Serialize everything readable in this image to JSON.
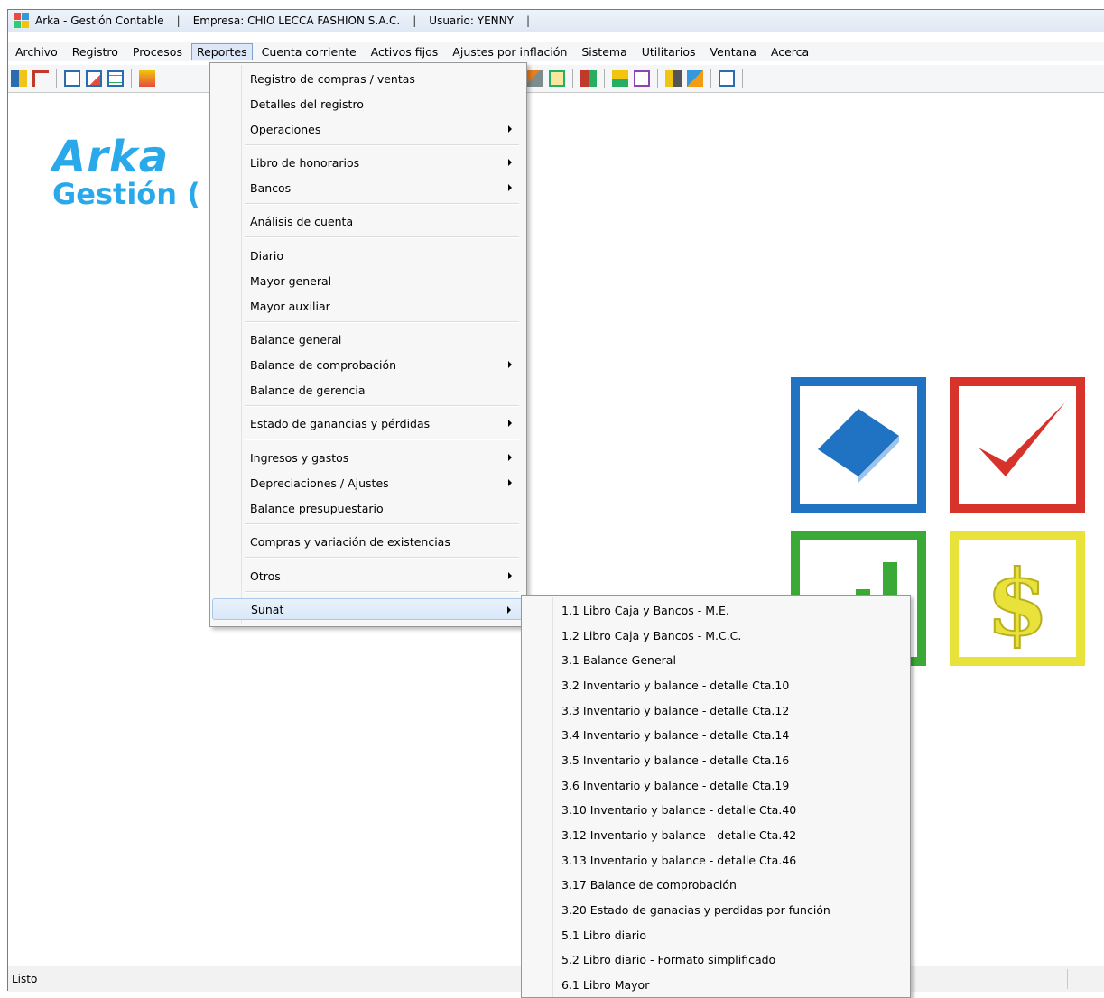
{
  "titlebar": {
    "app_title": "Arka - Gestión Contable",
    "company": "Empresa: CHIO LECCA FASHION S.A.C.",
    "user": "Usuario: YENNY",
    "separator": "|"
  },
  "menubar": {
    "items": [
      "Archivo",
      "Registro",
      "Procesos",
      "Reportes",
      "Cuenta corriente",
      "Activos fijos",
      "Ajustes por inflación",
      "Sistema",
      "Utilitarios",
      "Ventana",
      "Acerca"
    ],
    "active": "Reportes"
  },
  "logo": {
    "name": "Arka",
    "subtitle": "Gestión ("
  },
  "reportes_menu": {
    "items": [
      {
        "label": "Registro de compras / ventas",
        "submenu": false
      },
      {
        "label": "Detalles del registro",
        "submenu": false
      },
      {
        "label": "Operaciones",
        "submenu": true
      },
      {
        "label": "Libro de honorarios",
        "submenu": true
      },
      {
        "label": "Bancos",
        "submenu": true
      },
      {
        "label": "Análisis de cuenta",
        "submenu": false
      },
      {
        "label": "Diario",
        "submenu": false
      },
      {
        "label": "Mayor general",
        "submenu": false
      },
      {
        "label": "Mayor auxiliar",
        "submenu": false
      },
      {
        "label": "Balance general",
        "submenu": false
      },
      {
        "label": "Balance de comprobación",
        "submenu": true
      },
      {
        "label": "Balance de gerencia",
        "submenu": false
      },
      {
        "label": "Estado de ganancias y pérdidas",
        "submenu": true
      },
      {
        "label": "Ingresos y gastos",
        "submenu": true
      },
      {
        "label": "Depreciaciones / Ajustes",
        "submenu": true
      },
      {
        "label": "Balance presupuestario",
        "submenu": false
      },
      {
        "label": "Compras y variación de existencias",
        "submenu": false
      },
      {
        "label": "Otros",
        "submenu": true
      },
      {
        "label": "Sunat",
        "submenu": true,
        "highlighted": true
      }
    ]
  },
  "sunat_submenu": {
    "items": [
      "1.1  Libro Caja y Bancos - M.E.",
      "1.2  Libro Caja y Bancos - M.C.C.",
      "3.1  Balance General",
      "3.2  Inventario y balance - detalle Cta.10",
      "3.3  Inventario y balance - detalle Cta.12",
      "3.4  Inventario y balance - detalle Cta.14",
      "3.5  Inventario y balance - detalle Cta.16",
      "3.6  Inventario y balance - detalle Cta.19",
      "3.10 Inventario y balance - detalle Cta.40",
      "3.12 Inventario y balance - detalle Cta.42",
      "3.13 Inventario y balance - detalle Cta.46",
      "3.17 Balance de comprobación",
      "3.20 Estado de ganacias y perdidas por función",
      "5.1  Libro diario",
      "5.2  Libro diario - Formato simplificado",
      "6.1  Libro Mayor"
    ]
  },
  "status": {
    "text": "Listo"
  },
  "colors": {
    "logo": "#2aa9ea",
    "tile_blue": "#1f73c2",
    "tile_red": "#d8332b",
    "tile_green": "#3aa935",
    "tile_yellow": "#e8e23a"
  }
}
